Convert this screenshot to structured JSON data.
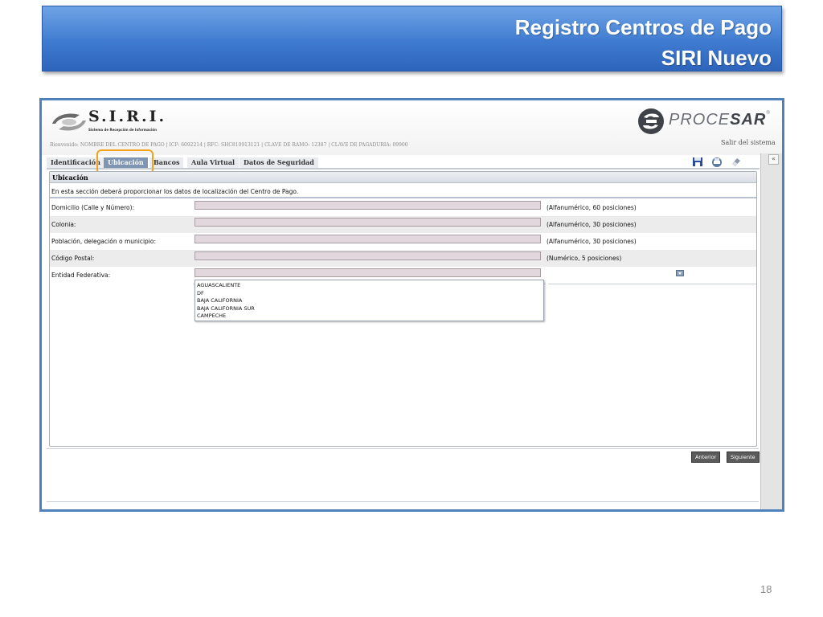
{
  "slide": {
    "title_line1": "Registro Centros de Pago",
    "title_line2": "SIRI Nuevo",
    "page_number": "18"
  },
  "header": {
    "logo_title": "S.I.R.I.",
    "logo_subtitle": "Sistema de Recepción de Información",
    "welcome": "Bienvenido: NOMBRE DEL CENTRO DE PAGO  |  ICP: 6092214  |  RFC: SHC810913121  |  CLAVE DE RAMO: 12387  |  CLAVE DE PAGADURIA: 09900",
    "brand_light": "PROCE",
    "brand_bold": "SAR",
    "brand_mark": "®",
    "logout_label": "Salir del sistema"
  },
  "tabs": [
    {
      "label": "Identificación"
    },
    {
      "label": "Ubicación"
    },
    {
      "label": "Bancos"
    },
    {
      "label": "Aula Virtual"
    },
    {
      "label": "Datos de Seguridad"
    }
  ],
  "toolbar": {
    "collapse_label": "«"
  },
  "panel": {
    "title": "Ubicación",
    "description": "En esta sección deberá proporcionar los datos de localización del Centro de Pago."
  },
  "fields": [
    {
      "label": "Domicilio (Calle y Número):",
      "value": "",
      "hint": "(Alfanumérico, 60 posiciones)"
    },
    {
      "label": "Colonia:",
      "value": "",
      "hint": "(Alfanumérico, 30 posiciones)"
    },
    {
      "label": "Población, delegación o municipio:",
      "value": "",
      "hint": "(Alfanumérico, 30 posiciones)"
    },
    {
      "label": "Código Postal:",
      "value": "",
      "hint": "(Numérico, 5 posiciones)"
    },
    {
      "label": "Entidad Federativa:",
      "value": ""
    }
  ],
  "entidad_options": [
    "AGUASCALIENTE",
    "DF",
    "BAJA CALIFORNIA",
    "BAJA CALIFORNIA SUR",
    "CAMPECHE"
  ],
  "nav": {
    "prev_label": "Anterior",
    "next_label": "Siguiente"
  },
  "colors": {
    "banner_blue": "#4f81bd",
    "active_tab": "#7f95b1",
    "highlight_orange": "#f5a21a",
    "field_fill": "#e2d7dc"
  }
}
